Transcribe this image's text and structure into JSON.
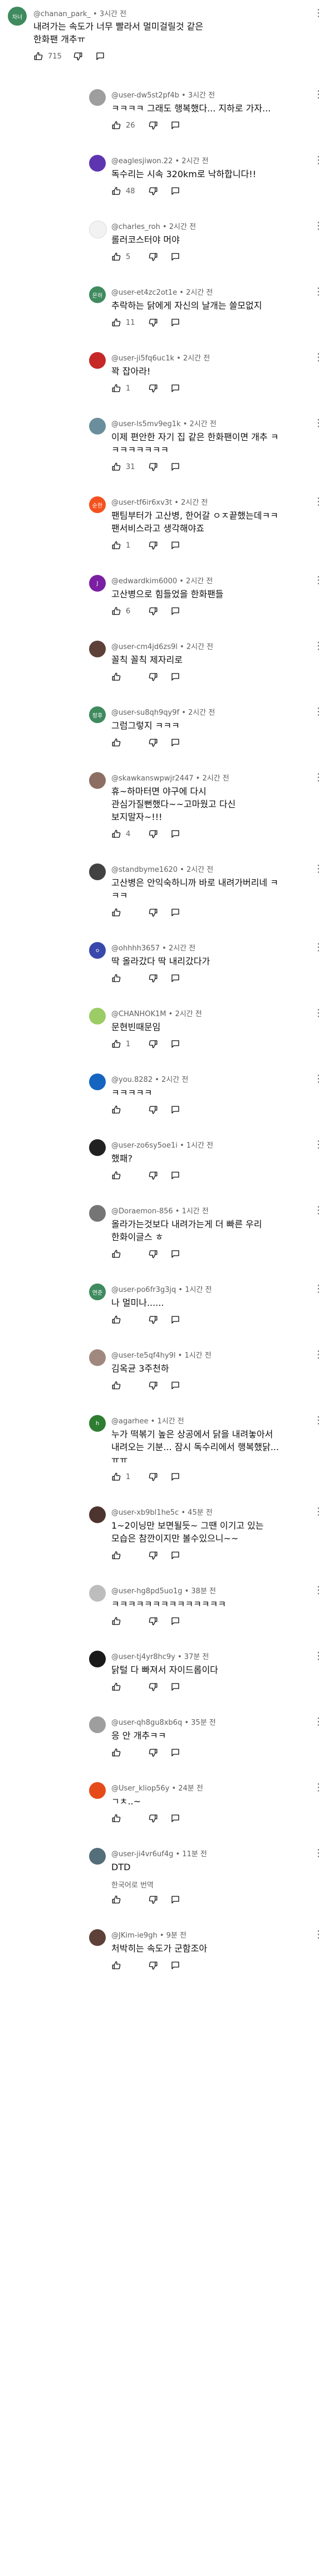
{
  "colors": {
    "text": "#0f0f0f",
    "meta": "#606060",
    "background": "#ffffff"
  },
  "icons": {
    "like": "thumb-up-icon",
    "dislike": "thumb-down-icon",
    "reply": "comment-bubble-icon",
    "more": "more-vertical-icon"
  },
  "top_comment": {
    "avatar_text": "차너",
    "avatar_color": "#3f8a5e",
    "author": "@chanan_park_",
    "time": "3시간 전",
    "lines": [
      "내려가는 속도가 너무 빨라서 멀미걸릴것 같은",
      "한화팬 개추ㅠ"
    ],
    "likes": "715"
  },
  "replies": [
    {
      "author": "@user-dw5st2pf4b",
      "time": "3시간 전",
      "avatar_color": "#9e9e9e",
      "avatar_text": "",
      "lines": [
        "ㅋㅋㅋㅋ 그래도 행복했다... 지하로 가자..."
      ],
      "likes": "26"
    },
    {
      "author": "@eaglesjiwon.22",
      "time": "2시간 전",
      "avatar_color": "#5e35b1",
      "avatar_text": "",
      "lines": [
        "독수리는 시속 320km로 낙하합니다!!"
      ],
      "likes": "48"
    },
    {
      "author": "@charles_roh",
      "time": "2시간 전",
      "avatar_color": "#f2f2f2",
      "avatar_text": "",
      "lines": [
        "롤러코스터야 머야"
      ],
      "likes": "5"
    },
    {
      "author": "@user-et4zc2ot1e",
      "time": "2시간 전",
      "avatar_color": "#3f8a5e",
      "avatar_text": "은하",
      "lines": [
        "추락하는 닭에게 자신의 날개는 쓸모없지"
      ],
      "likes": "11"
    },
    {
      "author": "@user-ji5fq6uc1k",
      "time": "2시간 전",
      "avatar_color": "#c62828",
      "avatar_text": "",
      "lines": [
        "꽉 잡아라!"
      ],
      "likes": "1"
    },
    {
      "author": "@user-ls5mv9eg1k",
      "time": "2시간 전",
      "avatar_color": "#6b8e9c",
      "avatar_text": "",
      "lines": [
        "이제 편안한 자기 집 같은 한화팬이면 개추 ㅋ",
        "ㅋㅋㅋㅋㅋㅋㅋ"
      ],
      "likes": "31"
    },
    {
      "author": "@user-tf6ir6xv3t",
      "time": "2시간 전",
      "avatar_color": "#f4511e",
      "avatar_text": "순한",
      "lines": [
        "팬팀부터가 고산병, 한어갈 ㅇㅈ끝했는데ㅋㅋ",
        "팬서비스라고 생각해야죠"
      ],
      "likes": "1"
    },
    {
      "author": "@edwardkim6000",
      "time": "2시간 전",
      "avatar_color": "#7b1fa2",
      "avatar_text": "J",
      "lines": [
        "고산병으로 힘들었을 한화팬들"
      ],
      "likes": "6"
    },
    {
      "author": "@user-cm4jd6zs9l",
      "time": "2시간 전",
      "avatar_color": "#5d4037",
      "avatar_text": "",
      "lines": [
        "꼴칙  꼴칙  제자리로"
      ],
      "likes": ""
    },
    {
      "author": "@user-su8qh9qy9f",
      "time": "2시간 전",
      "avatar_color": "#3f8a5e",
      "avatar_text": "정후",
      "lines": [
        "그럼그렇지 ㅋㅋㅋ"
      ],
      "likes": ""
    },
    {
      "author": "@skawkanswpwjr2447",
      "time": "2시간 전",
      "avatar_color": "#8d6e63",
      "avatar_text": "",
      "lines": [
        "휴~하마터면 야구에 다시",
        "관심가질뻔했다~~고마웠고 다신",
        "보지말자~!!!"
      ],
      "likes": "4"
    },
    {
      "author": "@standbyme1620",
      "time": "2시간 전",
      "avatar_color": "#424242",
      "avatar_text": "",
      "lines": [
        "고산병은 안익숙하니까 바로 내려가버리네 ㅋ",
        "ㅋㅋ"
      ],
      "likes": ""
    },
    {
      "author": "@ohhhh3657",
      "time": "2시간 전",
      "avatar_color": "#3949ab",
      "avatar_text": "o",
      "lines": [
        "딱 올라갔다 딱 내리갔다가"
      ],
      "likes": ""
    },
    {
      "author": "@CHANHOK1M",
      "time": "2시간 전",
      "avatar_color": "#9ccc65",
      "avatar_text": "",
      "lines": [
        "문현빈때문임"
      ],
      "likes": "1"
    },
    {
      "author": "@you.8282",
      "time": "2시간 전",
      "avatar_color": "#1565c0",
      "avatar_text": "",
      "lines": [
        "ㅋㅋㅋㅋㅋ"
      ],
      "likes": ""
    },
    {
      "author": "@user-zo6sy5oe1i",
      "time": "1시간 전",
      "avatar_color": "#212121",
      "avatar_text": "",
      "lines": [
        "했패?"
      ],
      "likes": ""
    },
    {
      "author": "@Doraemon-856",
      "time": "1시간 전",
      "avatar_color": "#757575",
      "avatar_text": "",
      "lines": [
        "올라가는것보다 내려가는게 더 빠른 우리",
        "한화이글스 ㅎ"
      ],
      "likes": ""
    },
    {
      "author": "@user-po6fr3g3jq",
      "time": "1시간 전",
      "avatar_color": "#3f8a5e",
      "avatar_text": "연준",
      "lines": [
        "나 멀미나......"
      ],
      "likes": ""
    },
    {
      "author": "@user-te5qf4hy9l",
      "time": "1시간 전",
      "avatar_color": "#a1887f",
      "avatar_text": "",
      "lines": [
        "김옥균 3주천하"
      ],
      "likes": ""
    },
    {
      "author": "@agarhee",
      "time": "1시간 전",
      "avatar_color": "#2e7d32",
      "avatar_text": "h",
      "lines": [
        "누가 떡볶기 높은 상공에서 닭을 내려놓아서",
        "내려오는 기분... 잠시 독수리에서 행복했닭...",
        "ㅠㅠ"
      ],
      "likes": "1"
    },
    {
      "author": "@user-xb9bl1he5c",
      "time": "45분 전",
      "avatar_color": "#4e342e",
      "avatar_text": "",
      "lines": [
        "1~2이닝만 보면될듯~ 그땐 이기고 있는",
        "모습은 참깐이지만 볼수있으니~~"
      ],
      "likes": ""
    },
    {
      "author": "@user-hg8pd5uo1g",
      "time": "38분 전",
      "avatar_color": "#bdbdbd",
      "avatar_text": "",
      "lines": [
        "ㅋㅋㅋㅋㅋㅋㅋㅋㅋㅋㅋㅋㅋㅋ"
      ],
      "likes": ""
    },
    {
      "author": "@user-tj4yr8hc9y",
      "time": "37분 전",
      "avatar_color": "#1a1a1a",
      "avatar_text": "",
      "lines": [
        "닭털 다 빠져서 자이드롭이다"
      ],
      "likes": ""
    },
    {
      "author": "@user-qh8gu8xb6q",
      "time": "35분 전",
      "avatar_color": "#9e9e9e",
      "avatar_text": "",
      "lines": [
        "응 안 개추ㅋㅋ"
      ],
      "likes": ""
    },
    {
      "author": "@User_kliop56y",
      "time": "24분 전",
      "avatar_color": "#e64a19",
      "avatar_text": "",
      "lines": [
        "ㄱㅊ..~"
      ],
      "likes": ""
    },
    {
      "author": "@user-ji4vr6uf4g",
      "time": "11분 전",
      "avatar_color": "#546e7a",
      "avatar_text": "",
      "lines": [
        "DTD"
      ],
      "likes": "",
      "translate": "한국어로 번역"
    },
    {
      "author": "@JKim-ie9gh",
      "time": "9분 전",
      "avatar_color": "#5d4037",
      "avatar_text": "",
      "lines": [
        "처박히는 속도가 군함조아"
      ],
      "likes": ""
    }
  ]
}
